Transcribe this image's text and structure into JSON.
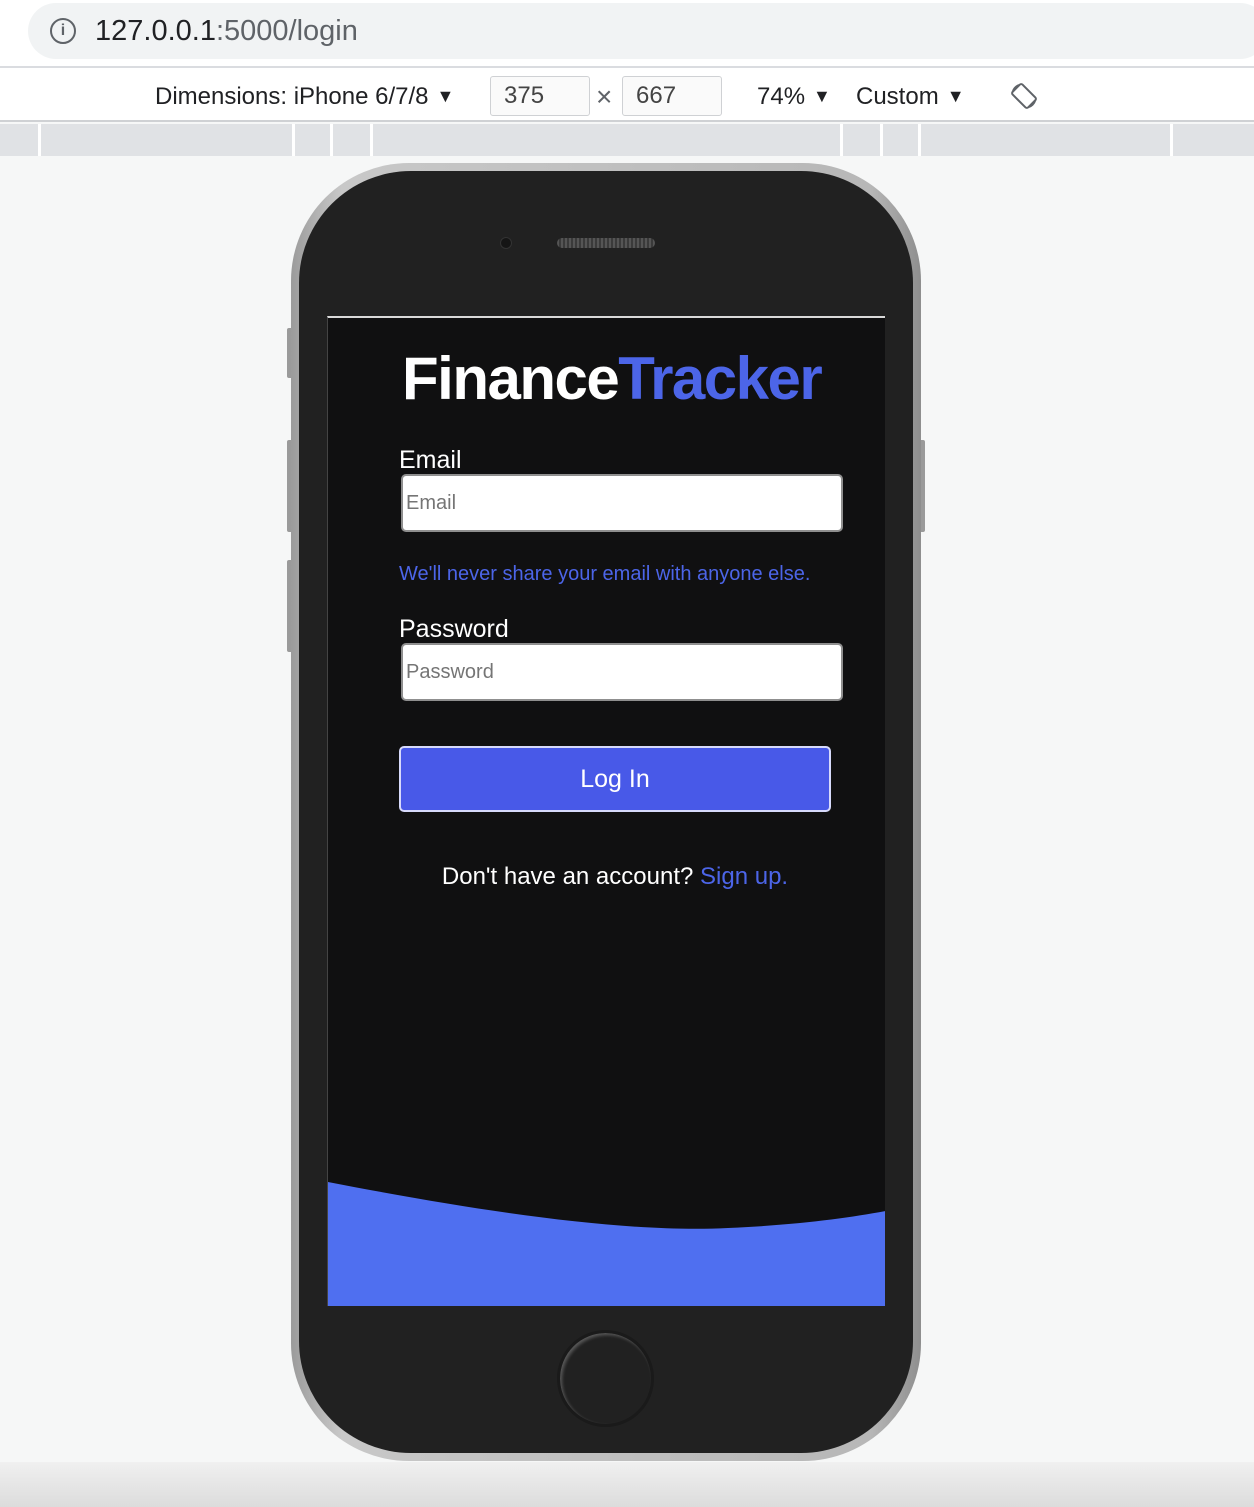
{
  "browser": {
    "url_host": "127.0.0.1",
    "url_path": ":5000/login"
  },
  "device_toolbar": {
    "dimensions_label": "Dimensions: iPhone 6/7/8",
    "width": "375",
    "height": "667",
    "zoom": "74%",
    "throttle": "Custom"
  },
  "app": {
    "logo_part1": "Finance",
    "logo_part2": "Tracker",
    "email_label": "Email",
    "email_placeholder": "Email",
    "email_help": "We'll never share your email with anyone else.",
    "password_label": "Password",
    "password_placeholder": "Password",
    "login_button": "Log In",
    "signup_prompt": "Don't have an account?",
    "signup_link": "Sign up.",
    "accent_color": "#4c65e8",
    "background_color": "#101011"
  }
}
